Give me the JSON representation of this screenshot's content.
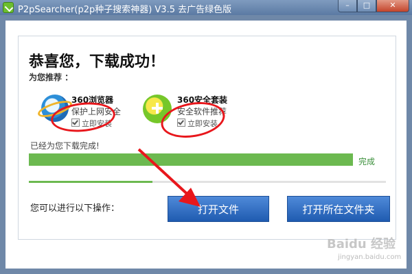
{
  "window": {
    "title": "P2pSearcher(p2p种子搜索神器) V3.5 去广告绿色版",
    "controls": {
      "minimize": "–",
      "maximize": "□",
      "close": "✕"
    }
  },
  "main": {
    "headline": "恭喜您，下载成功！",
    "recommend_label": "为您推荐 ：",
    "products": [
      {
        "name": "360浏览器",
        "desc": "保护上网安全",
        "check_label": "立即安装",
        "checked": true,
        "icon": "ie-browser-icon"
      },
      {
        "name": "360安全套装",
        "desc": "安全软件推荐",
        "check_label": "立即安装",
        "checked": true,
        "icon": "360-safe-icon"
      }
    ],
    "status": "已经为您下载完成!",
    "progress": {
      "fraction": 1.0,
      "label": "完成"
    },
    "operations_label": "您可以进行以下操作：",
    "buttons": {
      "open_file": "打开文件",
      "open_folder": "打开所在文件夹"
    }
  },
  "watermark": {
    "text": "Baidu 经验",
    "sub": "jingyan.baidu.com"
  },
  "colors": {
    "titlebar": "#6f88a8",
    "progress": "#6cb950",
    "button": "#2f6bc1",
    "annotation": "#e8171c"
  }
}
